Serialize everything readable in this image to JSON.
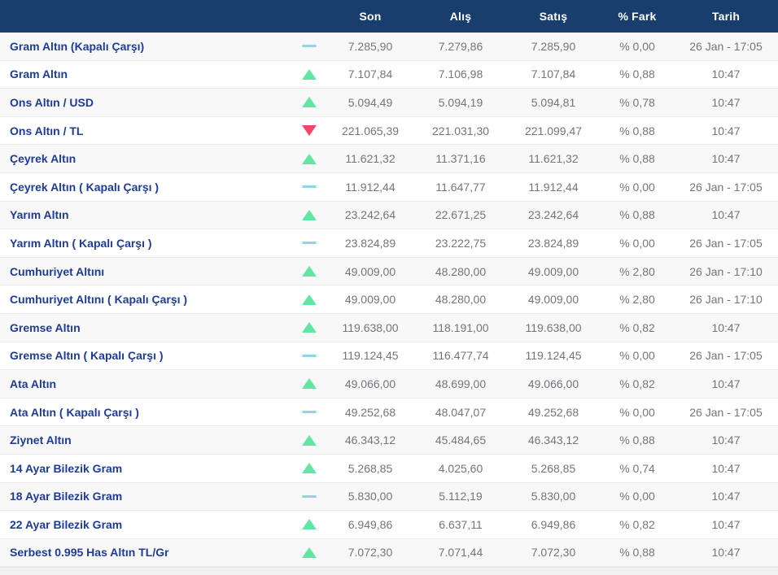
{
  "table": {
    "columns": [
      {
        "key": "son",
        "label": "Son"
      },
      {
        "key": "alis",
        "label": "Alış"
      },
      {
        "key": "satis",
        "label": "Satış"
      },
      {
        "key": "fark",
        "label": "% Fark"
      },
      {
        "key": "tarih",
        "label": "Tarih"
      }
    ],
    "rows": [
      {
        "name": "Gram Altın (Kapalı Çarşı)",
        "trend": "flat",
        "son": "7.285,90",
        "alis": "7.279,86",
        "satis": "7.285,90",
        "fark": "% 0,00",
        "tarih": "26 Jan - 17:05"
      },
      {
        "name": "Gram Altın",
        "trend": "up",
        "son": "7.107,84",
        "alis": "7.106,98",
        "satis": "7.107,84",
        "fark": "% 0,88",
        "tarih": "10:47"
      },
      {
        "name": "Ons Altın / USD",
        "trend": "up",
        "son": "5.094,49",
        "alis": "5.094,19",
        "satis": "5.094,81",
        "fark": "% 0,78",
        "tarih": "10:47"
      },
      {
        "name": "Ons Altın / TL",
        "trend": "down",
        "son": "221.065,39",
        "alis": "221.031,30",
        "satis": "221.099,47",
        "fark": "% 0,88",
        "tarih": "10:47"
      },
      {
        "name": "Çeyrek Altın",
        "trend": "up",
        "son": "11.621,32",
        "alis": "11.371,16",
        "satis": "11.621,32",
        "fark": "% 0,88",
        "tarih": "10:47"
      },
      {
        "name": "Çeyrek Altın ( Kapalı Çarşı )",
        "trend": "flat",
        "son": "11.912,44",
        "alis": "11.647,77",
        "satis": "11.912,44",
        "fark": "% 0,00",
        "tarih": "26 Jan - 17:05"
      },
      {
        "name": "Yarım Altın",
        "trend": "up",
        "son": "23.242,64",
        "alis": "22.671,25",
        "satis": "23.242,64",
        "fark": "% 0,88",
        "tarih": "10:47"
      },
      {
        "name": "Yarım Altın ( Kapalı Çarşı )",
        "trend": "flat",
        "son": "23.824,89",
        "alis": "23.222,75",
        "satis": "23.824,89",
        "fark": "% 0,00",
        "tarih": "26 Jan - 17:05"
      },
      {
        "name": "Cumhuriyet Altını",
        "trend": "up",
        "son": "49.009,00",
        "alis": "48.280,00",
        "satis": "49.009,00",
        "fark": "% 2,80",
        "tarih": "26 Jan - 17:10"
      },
      {
        "name": "Cumhuriyet Altını ( Kapalı Çarşı )",
        "trend": "up",
        "son": "49.009,00",
        "alis": "48.280,00",
        "satis": "49.009,00",
        "fark": "% 2,80",
        "tarih": "26 Jan - 17:10"
      },
      {
        "name": "Gremse Altın",
        "trend": "up",
        "son": "119.638,00",
        "alis": "118.191,00",
        "satis": "119.638,00",
        "fark": "% 0,82",
        "tarih": "10:47"
      },
      {
        "name": "Gremse Altın ( Kapalı Çarşı )",
        "trend": "flat",
        "son": "119.124,45",
        "alis": "116.477,74",
        "satis": "119.124,45",
        "fark": "% 0,00",
        "tarih": "26 Jan - 17:05"
      },
      {
        "name": "Ata Altın",
        "trend": "up",
        "son": "49.066,00",
        "alis": "48.699,00",
        "satis": "49.066,00",
        "fark": "% 0,82",
        "tarih": "10:47"
      },
      {
        "name": "Ata Altın ( Kapalı Çarşı )",
        "trend": "flat",
        "son": "49.252,68",
        "alis": "48.047,07",
        "satis": "49.252,68",
        "fark": "% 0,00",
        "tarih": "26 Jan - 17:05"
      },
      {
        "name": "Ziynet Altın",
        "trend": "up",
        "son": "46.343,12",
        "alis": "45.484,65",
        "satis": "46.343,12",
        "fark": "% 0,88",
        "tarih": "10:47"
      },
      {
        "name": "14 Ayar Bilezik Gram",
        "trend": "up",
        "son": "5.268,85",
        "alis": "4.025,60",
        "satis": "5.268,85",
        "fark": "% 0,74",
        "tarih": "10:47"
      },
      {
        "name": "18 Ayar Bilezik Gram",
        "trend": "flat",
        "son": "5.830,00",
        "alis": "5.112,19",
        "satis": "5.830,00",
        "fark": "% 0,00",
        "tarih": "10:47"
      },
      {
        "name": "22 Ayar Bilezik Gram",
        "trend": "up",
        "son": "6.949,86",
        "alis": "6.637,11",
        "satis": "6.949,86",
        "fark": "% 0,82",
        "tarih": "10:47"
      },
      {
        "name": "Serbest 0.995 Has Altın TL/Gr",
        "trend": "up",
        "son": "7.072,30",
        "alis": "7.071,44",
        "satis": "7.072,30",
        "fark": "% 0,88",
        "tarih": "10:47"
      }
    ],
    "colors": {
      "header_bg": "#183E6E",
      "header_text": "#FFFFFF",
      "instrument_text": "#1E3C96",
      "value_text": "#72757A",
      "trend_up": "#61E7A3",
      "trend_down": "#F4456B",
      "trend_flat": "#8FD6E3",
      "row_alt_bg": "#F8F8F9"
    }
  }
}
